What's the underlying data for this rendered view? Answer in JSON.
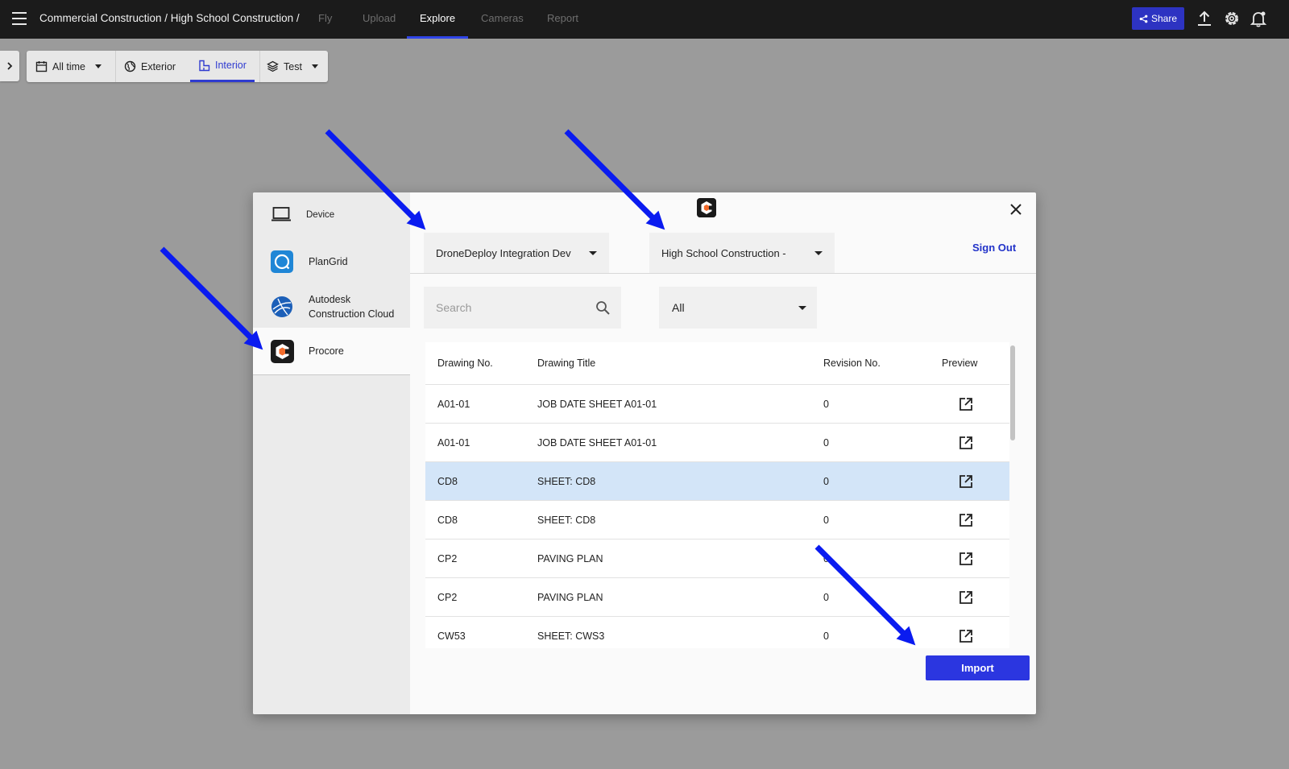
{
  "topbar": {
    "breadcrumb": "Commercial Construction / High School Construction /",
    "tabs": [
      {
        "label": "Fly"
      },
      {
        "label": "Upload"
      },
      {
        "label": "Explore"
      },
      {
        "label": "Cameras"
      },
      {
        "label": "Report"
      }
    ],
    "active_tab": "Explore",
    "share_label": "Share"
  },
  "toolbar": {
    "time_label": "All time",
    "exterior_label": "Exterior",
    "interior_label": "Interior",
    "layer_label": "Test"
  },
  "modal": {
    "sources": [
      {
        "label": "Device"
      },
      {
        "label": "PlanGrid"
      },
      {
        "label": "Autodesk Construction Cloud"
      },
      {
        "label": "Procore"
      }
    ],
    "active_source": "Procore",
    "company_select": "DroneDeploy Integration Dev",
    "project_select": "High School Construction - ",
    "sign_out_label": "Sign Out",
    "search_placeholder": "Search",
    "filter_select": "All",
    "table": {
      "headers": {
        "number": "Drawing No.",
        "title": "Drawing Title",
        "revision": "Revision No.",
        "preview": "Preview"
      },
      "rows": [
        {
          "number": "A01-01",
          "title": "JOB DATE SHEET A01-01",
          "revision": "0"
        },
        {
          "number": "A01-01",
          "title": "JOB DATE SHEET A01-01",
          "revision": "0"
        },
        {
          "number": "CD8",
          "title": "SHEET: CD8",
          "revision": "0",
          "selected": true
        },
        {
          "number": "CD8",
          "title": "SHEET: CD8",
          "revision": "0"
        },
        {
          "number": "CP2",
          "title": "PAVING PLAN",
          "revision": "0"
        },
        {
          "number": "CP2",
          "title": "PAVING PLAN",
          "revision": "0"
        },
        {
          "number": "CW53",
          "title": "SHEET: CWS3",
          "revision": "0"
        }
      ]
    },
    "import_label": "Import"
  },
  "colors": {
    "accent": "#2b36e0",
    "topbar_bg": "#1b1b1b",
    "overlay_bg": "#9b9b9b",
    "selected_row": "#d3e5f8",
    "annotation_arrow": "#0a1bf0"
  }
}
